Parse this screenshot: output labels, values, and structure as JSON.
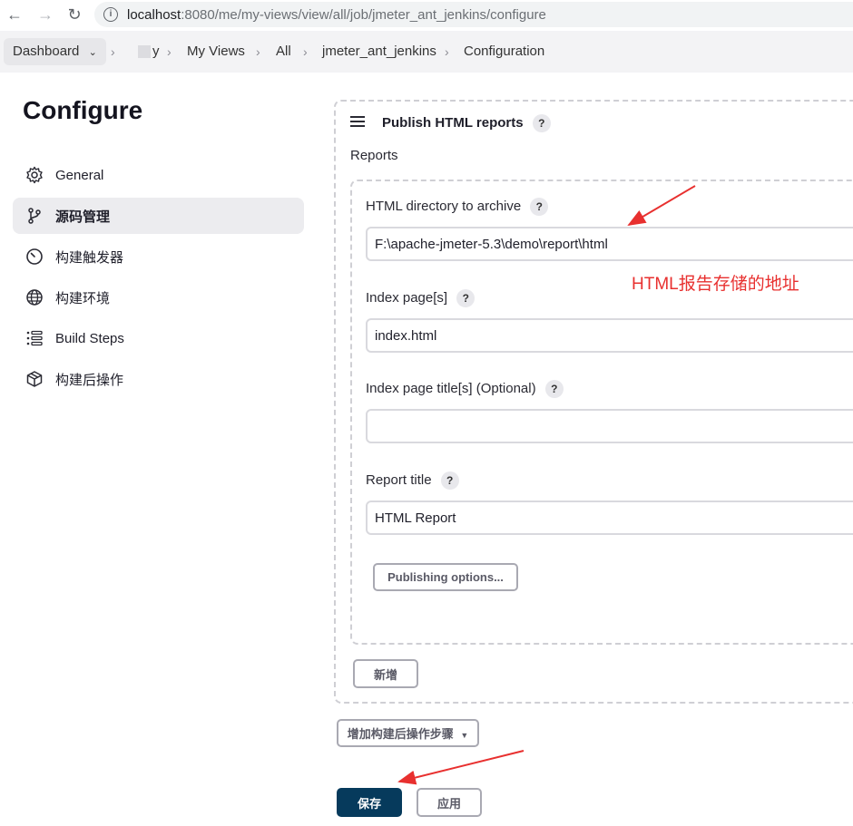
{
  "browser": {
    "url_host": "localhost",
    "url_path": ":8080/me/my-views/view/all/job/jmeter_ant_jenkins/configure"
  },
  "breadcrumb": {
    "dashboard": "Dashboard",
    "user_partial": "y",
    "my_views": "My Views",
    "all": "All",
    "job": "jmeter_ant_jenkins",
    "configuration": "Configuration"
  },
  "page": {
    "title": "Configure"
  },
  "sidebar": {
    "items": [
      {
        "label": "General",
        "icon": "gear-icon"
      },
      {
        "label": "源码管理",
        "icon": "source-branch-icon",
        "active": true
      },
      {
        "label": "构建触发器",
        "icon": "timer-icon"
      },
      {
        "label": "构建环境",
        "icon": "globe-icon"
      },
      {
        "label": "Build Steps",
        "icon": "list-icon"
      },
      {
        "label": "构建后操作",
        "icon": "package-icon"
      }
    ]
  },
  "section": {
    "title": "Publish HTML reports",
    "reports_label": "Reports",
    "fields": {
      "dir_label": "HTML directory to archive",
      "dir_value": "F:\\apache-jmeter-5.3\\demo\\report\\html",
      "index_label": "Index page[s]",
      "index_value": "index.html",
      "index_title_label": "Index page title[s] (Optional)",
      "index_title_value": "",
      "report_title_label": "Report title",
      "report_title_value": "HTML Report"
    },
    "publishing_options_button": "Publishing options...",
    "add_button": "新增"
  },
  "add_post_build_button": "增加构建后操作步骤",
  "save_button": "保存",
  "apply_button": "应用",
  "annotation": "HTML报告存储的地址",
  "colors": {
    "annotation_red": "#e8302f",
    "primary_button": "#063a5c"
  }
}
